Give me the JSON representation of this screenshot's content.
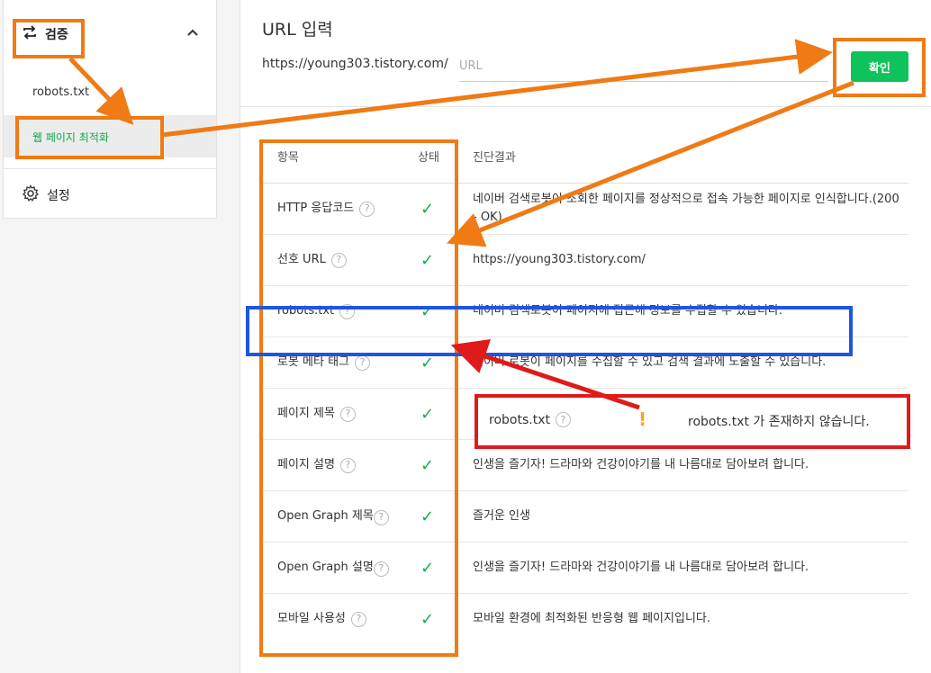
{
  "sidebar": {
    "group_label": "검증",
    "items": [
      {
        "label": "robots.txt"
      },
      {
        "label": "웹 페이지 최적화"
      }
    ],
    "settings_label": "설정",
    "icons": {
      "group": "repeat-icon",
      "collapse": "chevron-up-icon",
      "settings": "gear-icon"
    }
  },
  "url_section": {
    "title": "URL 입력",
    "prefix": "https://young303.tistory.com/",
    "placeholder": "URL",
    "confirm_label": "확인"
  },
  "table": {
    "headers": {
      "item": "항목",
      "status": "상태",
      "result": "진단결과"
    },
    "rows": [
      {
        "item": "HTTP 응답코드",
        "status": "ok",
        "result": "네이버 검색로봇이 조회한 페이지를 정상적으로 접속 가능한 페이지로 인식합니다.(200 - OK)"
      },
      {
        "item": "선호 URL",
        "status": "ok",
        "result": "https://young303.tistory.com/"
      },
      {
        "item": "robots.txt",
        "status": "ok",
        "result": "네이버 검색로봇이 페이지에 접근해 정보를 수집할 수 있습니다."
      },
      {
        "item": "로봇 메타 태그",
        "status": "ok",
        "result": "네이버 로봇이 페이지를 수집할 수 있고 검색 결과에 노출할 수 있습니다."
      },
      {
        "item": "페이지 제목",
        "status": "ok",
        "result": ""
      },
      {
        "item": "페이지 설명",
        "status": "ok",
        "result": "인생을 즐기자! 드라마와 건강이야기를 내 나름대로 담아보려 합니다."
      },
      {
        "item": "Open Graph 제목",
        "status": "ok",
        "result": "즐거운 인생"
      },
      {
        "item": "Open Graph 설명",
        "status": "ok",
        "result": "인생을 즐기자! 드라마와 건강이야기를 내 나름대로 담아보려 합니다."
      },
      {
        "item": "모바일 사용성",
        "status": "ok",
        "result": "모바일 환경에 최적화된 반응형 웹 페이지입니다."
      }
    ]
  },
  "overlay": {
    "item": "robots.txt",
    "status_icon": "warning-icon",
    "status_glyph": "!",
    "message": "robots.txt 가 존재하지 않습니다."
  },
  "colors": {
    "annotation_orange": "#f07a14",
    "annotation_blue": "#1e56e0",
    "annotation_red": "#e01a1a",
    "accent_green": "#0fc35c"
  }
}
